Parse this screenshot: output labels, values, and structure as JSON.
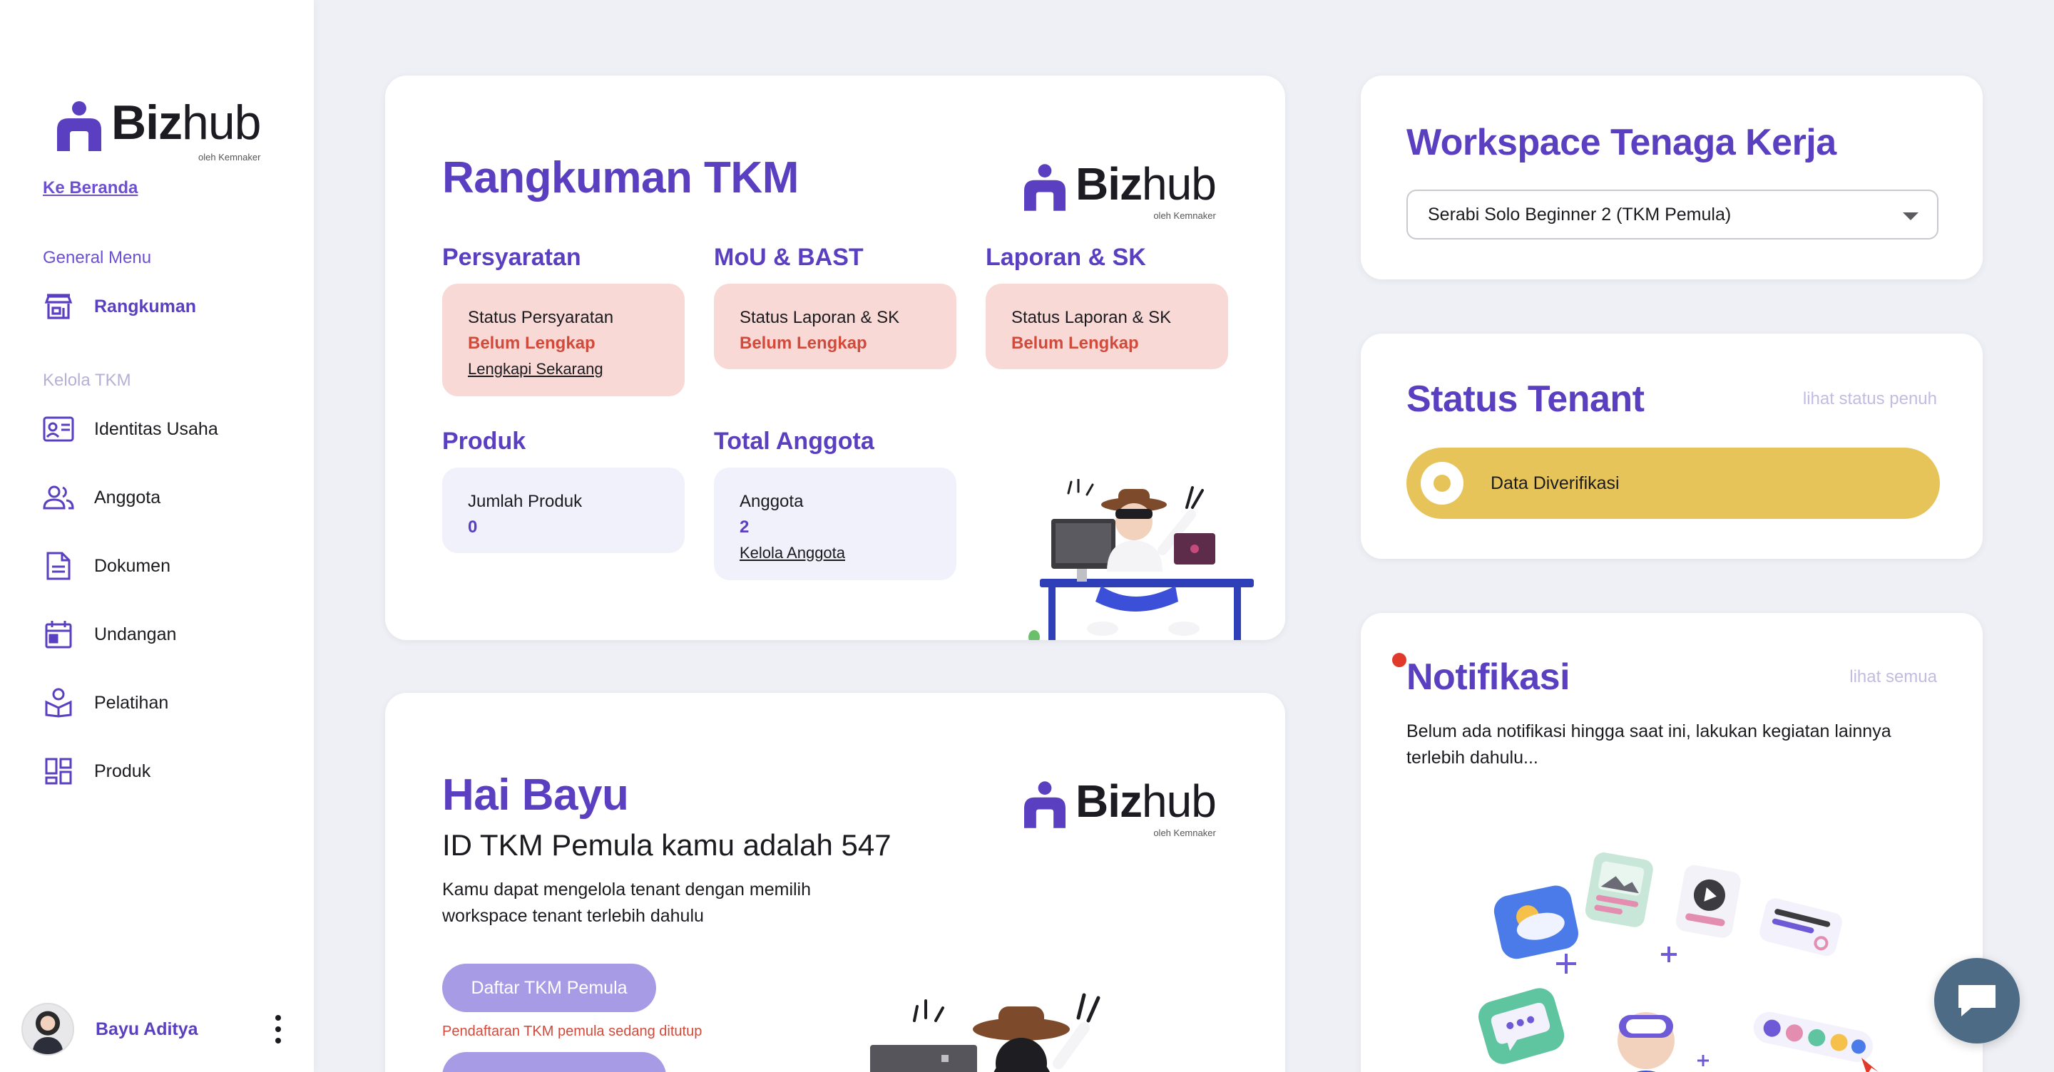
{
  "sidebar": {
    "logo": {
      "brand_bold": "Biz",
      "brand_light": "hub",
      "tagline": "oleh Kemnaker"
    },
    "home_link": "Ke Beranda",
    "general_title": "General Menu",
    "general_items": [
      {
        "label": "Rangkuman",
        "icon": "store-icon",
        "active": true
      }
    ],
    "kelola_title": "Kelola TKM",
    "kelola_items": [
      {
        "label": "Identitas Usaha",
        "icon": "id-card-icon"
      },
      {
        "label": "Anggota",
        "icon": "people-icon"
      },
      {
        "label": "Dokumen",
        "icon": "document-icon"
      },
      {
        "label": "Undangan",
        "icon": "calendar-icon"
      },
      {
        "label": "Pelatihan",
        "icon": "training-icon"
      },
      {
        "label": "Produk",
        "icon": "grid-icon"
      }
    ],
    "user": {
      "name": "Bayu Aditya"
    }
  },
  "summary": {
    "title": "Rangkuman TKM",
    "logo": {
      "brand_bold": "Biz",
      "brand_light": "hub",
      "tagline": "oleh Kemnaker"
    },
    "persyaratan": {
      "heading": "Persyaratan",
      "label": "Status Persyaratan",
      "status": "Belum Lengkap",
      "link": "Lengkapi Sekarang"
    },
    "mou": {
      "heading": "MoU & BAST",
      "label": "Status Laporan & SK",
      "status": "Belum Lengkap"
    },
    "laporan": {
      "heading": "Laporan & SK",
      "label": "Status Laporan & SK",
      "status": "Belum Lengkap"
    },
    "produk": {
      "heading": "Produk",
      "label": "Jumlah Produk",
      "value": "0"
    },
    "anggota": {
      "heading": "Total Anggota",
      "label": "Anggota",
      "value": "2",
      "link": "Kelola Anggota"
    }
  },
  "hai": {
    "title": "Hai Bayu",
    "subtitle": "ID TKM Pemula kamu adalah 547",
    "description": "Kamu dapat mengelola tenant dengan memilih workspace tenant terlebih dahulu",
    "button": "Daftar TKM Pemula",
    "warning": "Pendaftaran TKM pemula sedang ditutup",
    "logo": {
      "brand_bold": "Biz",
      "brand_light": "hub",
      "tagline": "oleh Kemnaker"
    }
  },
  "workspace": {
    "title": "Workspace Tenaga Kerja",
    "selected": "Serabi Solo Beginner 2 (TKM Pemula)"
  },
  "status_tenant": {
    "title": "Status Tenant",
    "link": "lihat status penuh",
    "status": "Data Diverifikasi"
  },
  "notifikasi": {
    "title": "Notifikasi",
    "link": "lihat semua",
    "empty_text": "Belum ada notifikasi hingga saat ini, lakukan kegiatan lainnya terlebih dahulu..."
  },
  "colors": {
    "accent": "#5a3fc0",
    "danger": "#d24a3b",
    "pending_bg": "#f8d9d6",
    "verified": "#e7c45a"
  }
}
